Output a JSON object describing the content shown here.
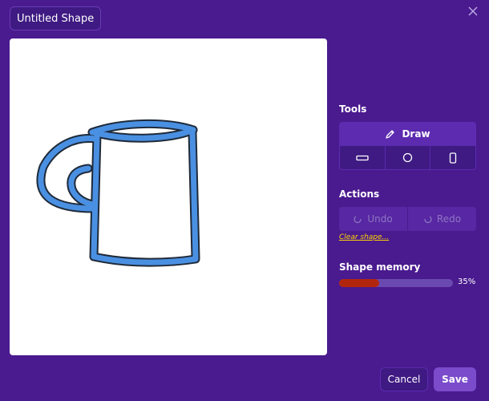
{
  "header": {
    "title": "Untitled Shape"
  },
  "icons": {
    "close": "close-icon",
    "draw": "pencil-icon",
    "rect": "rectangle-icon",
    "circle": "circle-icon",
    "phone": "rounded-rect-icon",
    "undo": "undo-icon",
    "redo": "redo-icon"
  },
  "tools": {
    "label": "Tools",
    "draw_label": "Draw"
  },
  "actions": {
    "label": "Actions",
    "undo_label": "Undo",
    "redo_label": "Redo",
    "clear_label": "Clear shape..."
  },
  "memory": {
    "label": "Shape memory",
    "percent": 35,
    "percent_label": "35%"
  },
  "footer": {
    "cancel_label": "Cancel",
    "save_label": "Save"
  },
  "colors": {
    "background": "#4a1a8f",
    "stroke": "#4a90e2",
    "memory_fill": "#b3260e",
    "link": "#ffd500"
  }
}
